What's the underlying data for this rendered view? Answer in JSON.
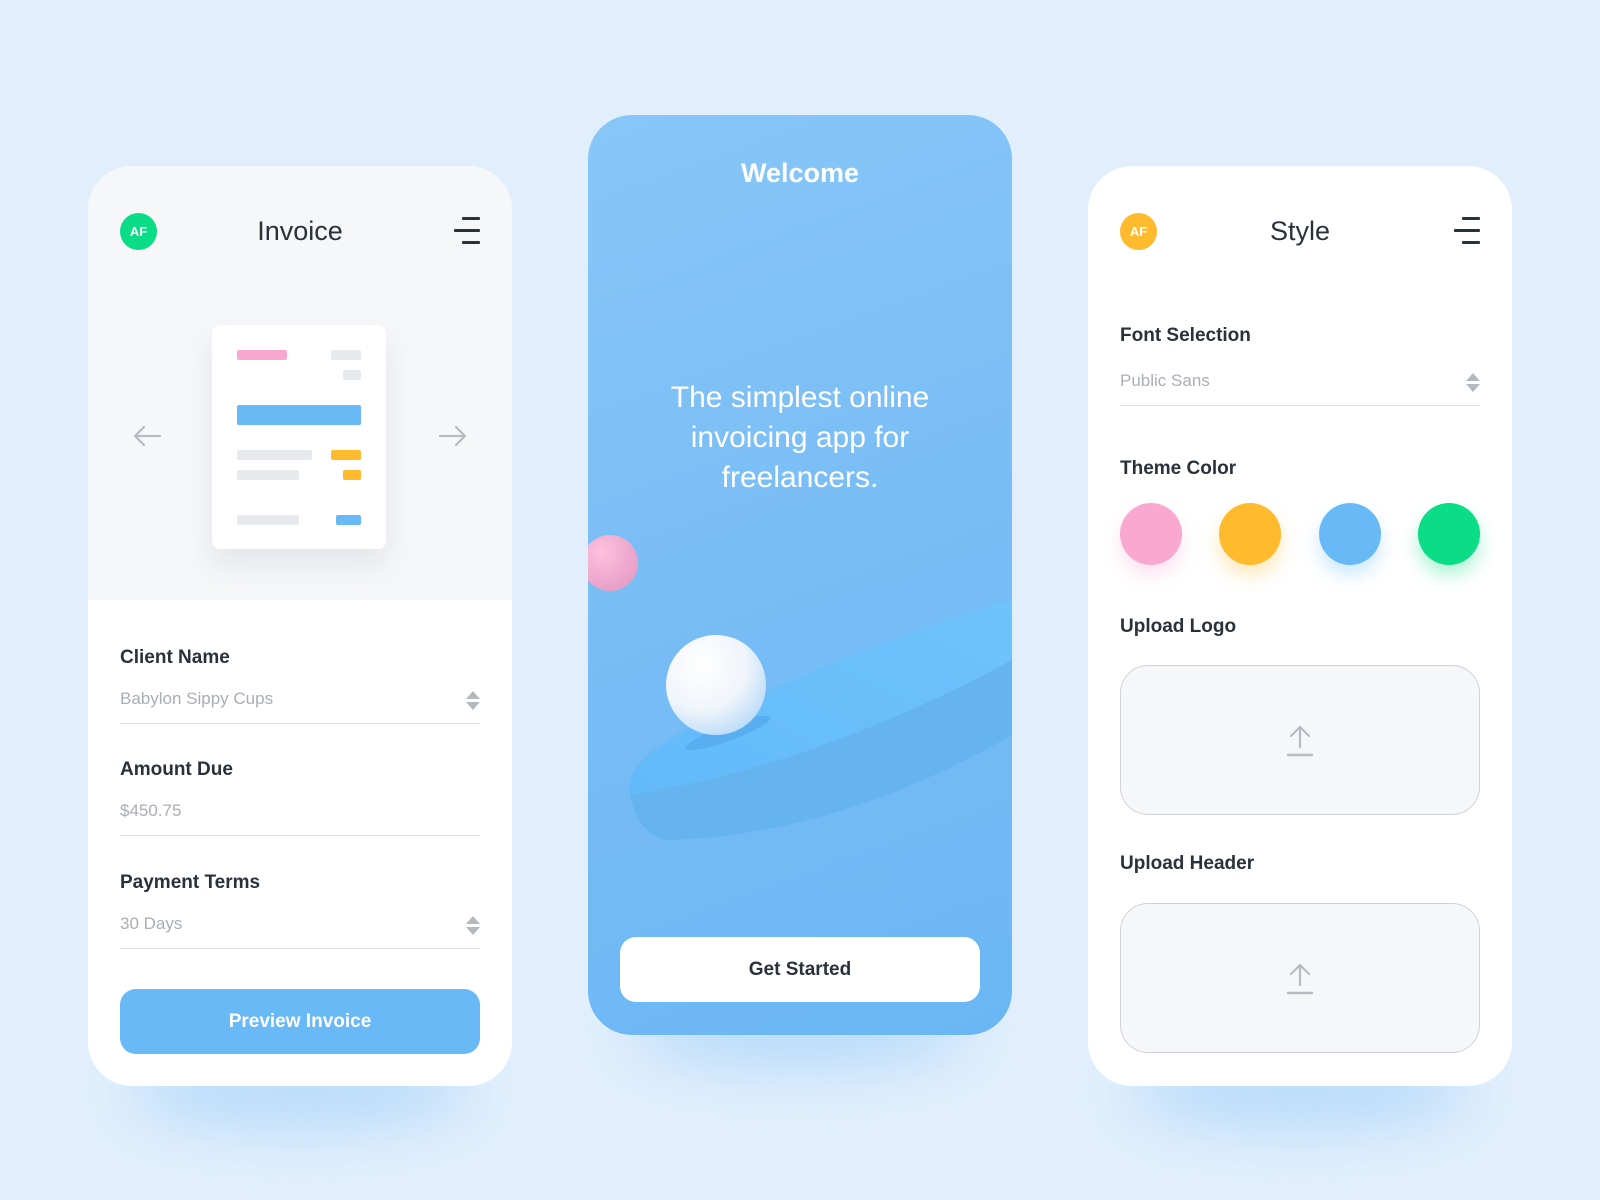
{
  "invoice_screen": {
    "avatar_initials": "AF",
    "avatar_color": "#0bdc86",
    "title": "Invoice",
    "menu_icon": "menu-icon",
    "prev_icon": "arrow-left-icon",
    "next_icon": "arrow-right-icon",
    "preview_colors": {
      "pink": "#f9a9cf",
      "gray": "#e6eaed",
      "blue": "#69b9f6",
      "yellow": "#ffba2e"
    },
    "fields": [
      {
        "label": "Client Name",
        "value": "Babylon Sippy Cups",
        "has_stepper": true
      },
      {
        "label": "Amount Due",
        "value": "$450.75",
        "has_stepper": false
      },
      {
        "label": "Payment Terms",
        "value": "30 Days",
        "has_stepper": true
      }
    ],
    "primary_button": "Preview Invoice"
  },
  "welcome_screen": {
    "title": "Welcome",
    "tagline": "The simplest online invoicing app for freelancers.",
    "cta_button": "Get Started"
  },
  "style_screen": {
    "avatar_initials": "AF",
    "avatar_color": "#ffba2e",
    "title": "Style",
    "menu_icon": "menu-icon",
    "font_selection": {
      "label": "Font Selection",
      "value": "Public Sans"
    },
    "theme_color": {
      "label": "Theme Color",
      "swatches": [
        {
          "name": "pink",
          "color": "#f9a9cf"
        },
        {
          "name": "yellow",
          "color": "#ffba2e"
        },
        {
          "name": "blue",
          "color": "#69b9f6"
        },
        {
          "name": "green",
          "color": "#0bdc86"
        }
      ]
    },
    "upload_logo": {
      "label": "Upload Logo",
      "icon": "upload-icon"
    },
    "upload_header": {
      "label": "Upload Header",
      "icon": "upload-icon"
    }
  }
}
